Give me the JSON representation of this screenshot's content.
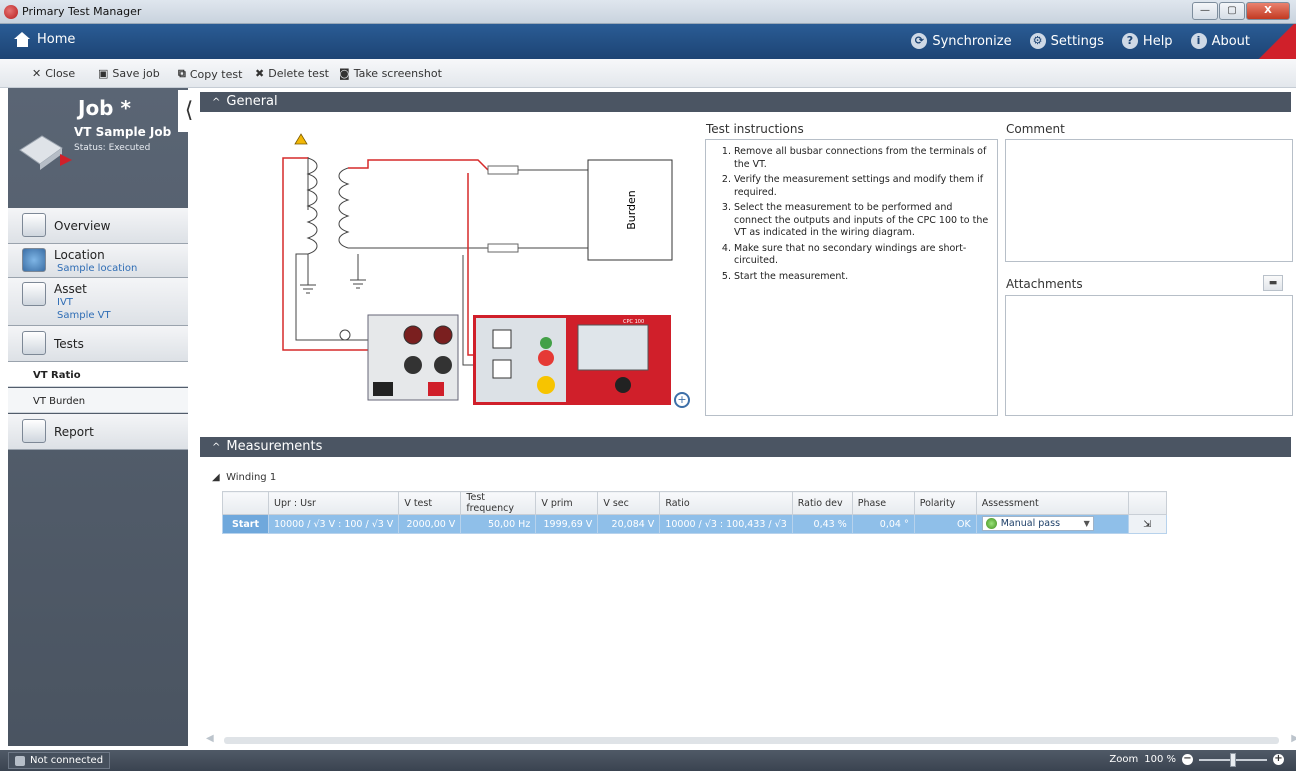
{
  "window": {
    "title": "Primary Test Manager",
    "min": "—",
    "max": "▢",
    "close": "X"
  },
  "nav": {
    "home": "Home",
    "items": [
      {
        "label": "Synchronize",
        "icon": "sync-icon",
        "glyph": "⟳"
      },
      {
        "label": "Settings",
        "icon": "gear-icon",
        "glyph": "⚙"
      },
      {
        "label": "Help",
        "icon": "help-icon",
        "glyph": "?"
      },
      {
        "label": "About",
        "icon": "info-icon",
        "glyph": "i"
      }
    ]
  },
  "toolbar": {
    "close": "Close",
    "save_job": "Save job",
    "copy_test": "Copy test",
    "delete_test": "Delete test",
    "take_screenshot": "Take screenshot"
  },
  "job": {
    "title": "Job *",
    "name": "VT Sample Job",
    "status": "Status: Executed"
  },
  "sidebar": {
    "overview": "Overview",
    "location": {
      "label": "Location",
      "sub": "Sample location"
    },
    "asset": {
      "label": "Asset",
      "sub1": "IVT",
      "sub2": "Sample VT"
    },
    "tests": "Tests",
    "test_items": [
      "VT Ratio",
      "VT Burden"
    ],
    "report": "Report"
  },
  "general": {
    "header": "General",
    "burden_label": "Burden",
    "device_label": "CPC 100",
    "test_instructions_label": "Test instructions",
    "instructions": [
      "Remove all busbar connections from the terminals of the VT.",
      "Verify the measurement settings and modify them if required.",
      "Select the measurement to be performed and connect the outputs and inputs of the CPC 100 to the VT as indicated in the wiring diagram.",
      "Make sure that no secondary windings are short-circuited.",
      "Start the measurement."
    ],
    "comment_label": "Comment",
    "attachments_label": "Attachments"
  },
  "measurements": {
    "header": "Measurements",
    "winding": "Winding 1",
    "columns": [
      "",
      "Upr : Usr",
      "V test",
      "Test frequency",
      "V prim",
      "V sec",
      "Ratio",
      "Ratio dev",
      "Phase",
      "Polarity",
      "Assessment",
      ""
    ],
    "row": {
      "start": "Start",
      "upr_usr": "10000 / √3 V : 100 / √3 V",
      "v_test": "2000,00 V",
      "test_frequency": "50,00 Hz",
      "v_prim": "1999,69 V",
      "v_sec": "20,084 V",
      "ratio": "10000 / √3 : 100,433 / √3",
      "ratio_dev": "0,43 %",
      "phase": "0,04 °",
      "polarity": "OK",
      "assessment": "Manual pass"
    }
  },
  "status": {
    "connection": "Not connected",
    "zoom_label": "Zoom",
    "zoom_value": "100 %"
  }
}
